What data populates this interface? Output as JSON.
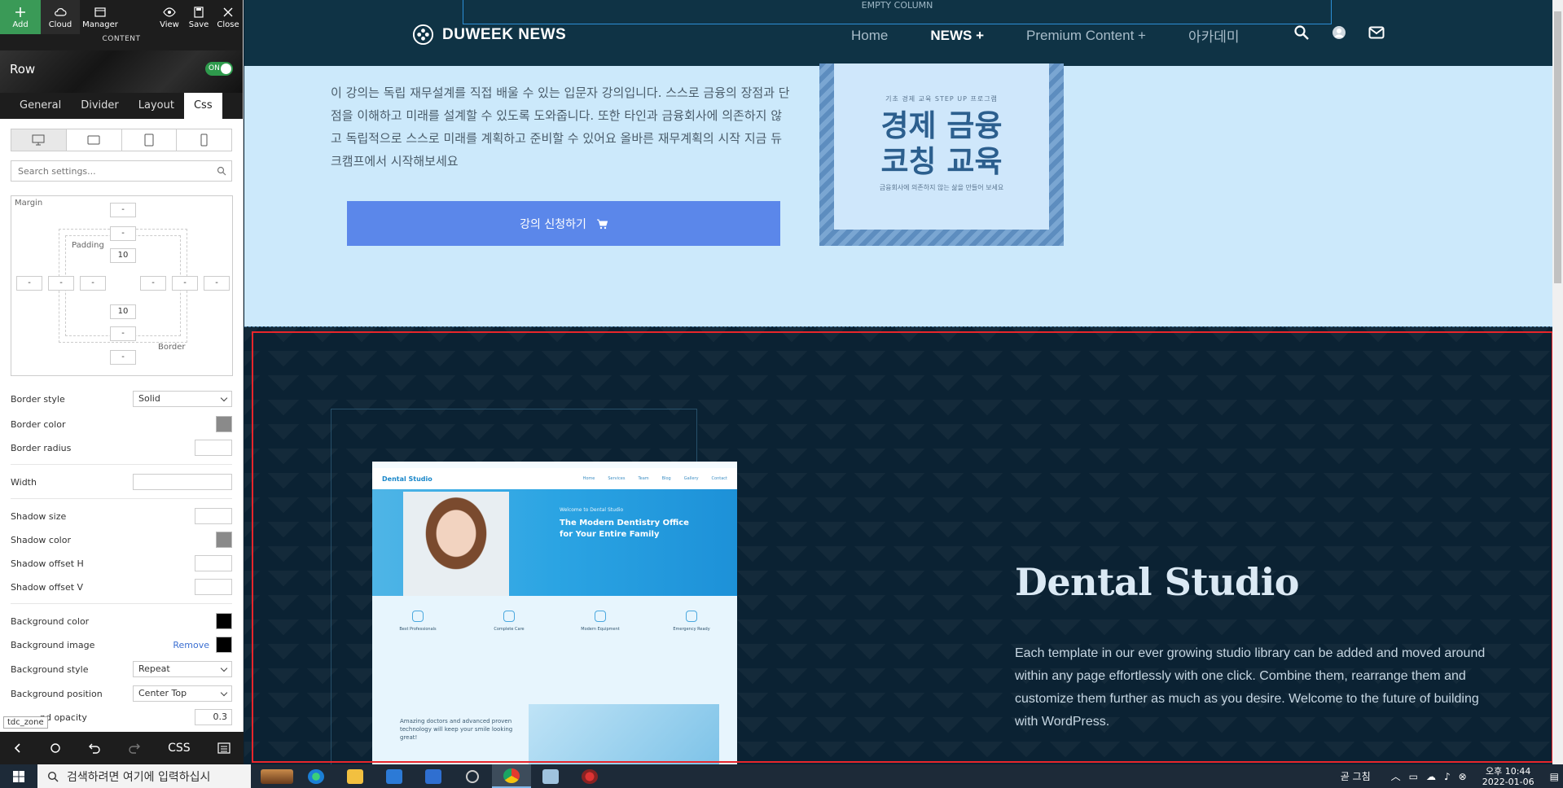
{
  "toolbar": {
    "add": "Add",
    "cloud": "Cloud",
    "manager": "Manager",
    "view": "View",
    "save": "Save",
    "close": "Close",
    "content_label": "CONTENT"
  },
  "row": {
    "title": "Row",
    "toggle": "ON"
  },
  "tabs": [
    "General",
    "Divider",
    "Layout",
    "Css"
  ],
  "search": {
    "placeholder": "Search settings..."
  },
  "box_model": {
    "margin_label": "Margin",
    "padding_label": "Padding",
    "border_label": "Border",
    "margin_top": "-",
    "margin_bottom": "-",
    "margin_left": "-",
    "margin_right": "-",
    "border_top": "-",
    "border_bottom": "-",
    "border_left": "-",
    "border_right": "-",
    "padding_top": "10",
    "padding_bottom": "10",
    "padding_left": "-",
    "padding_right": "-"
  },
  "props": {
    "border_style_label": "Border style",
    "border_style_value": "Solid",
    "border_color_label": "Border color",
    "border_radius_label": "Border radius",
    "width_label": "Width",
    "shadow_size_label": "Shadow size",
    "shadow_color_label": "Shadow color",
    "shadow_offset_h_label": "Shadow offset H",
    "shadow_offset_v_label": "Shadow offset V",
    "bg_color_label": "Background color",
    "bg_image_label": "Background image",
    "bg_image_remove": "Remove",
    "bg_style_label": "Background style",
    "bg_style_value": "Repeat",
    "bg_position_label": "Background position",
    "bg_position_value": "Center Top",
    "bg_opacity_label": "nd opacity",
    "bg_opacity_value": "0.3"
  },
  "tooltip": "tdc_zone",
  "bottom_bar": {
    "css": "CSS"
  },
  "site": {
    "empty_column": "EMPTY COLUMN",
    "logo": "DUWEEK NEWS",
    "nav": [
      "Home",
      "NEWS +",
      "Premium Content +",
      "아카데미"
    ],
    "hero_text": "이 강의는 독립 재무설계를 직접 배울 수 있는 입문자 강의입니다. 스스로 금융의 장점과 단점을 이해하고 미래를 설계할 수 있도록 도와줍니다. 또한 타인과 금융회사에 의존하지 않고 독립적으로 스스로 미래를 계획하고 준비할 수 있어요 올바른 재무계획의 시작 지금 듀크캠프에서 시작해보세요",
    "apply_button": "강의 신청하기",
    "book_sub": "기초 경제 교육 STEP UP 프로그램",
    "book_title_1": "경제 금융",
    "book_title_2": "코칭 교육",
    "book_foot": "금융회사에 의존하지 않는 삶을 만들어 보세요",
    "dental_title": "Dental Studio",
    "dental_desc": "Each template in our ever growing studio library can be added and moved around within any page effortlessly with one click. Combine them, rearrange them and customize them further as much as you desire. Welcome to the future of building with WordPress.",
    "mock": {
      "logo": "Dental Studio",
      "links": [
        "Home",
        "Services",
        "Team",
        "Blog",
        "Gallery",
        "Contact"
      ],
      "welcome": "Welcome to Dental Studio",
      "headline_1": "The Modern Dentistry Office",
      "headline_2": "for Your Entire Family",
      "features": [
        "Best Professionals",
        "Complete Care",
        "Modern Equipment",
        "Emergency Ready"
      ],
      "bottom_text": "Amazing doctors and advanced proven technology will keep your smile looking great!"
    }
  },
  "taskbar": {
    "search_placeholder": "검색하려면 여기에 입력하십시",
    "weather": "곧 그침",
    "time": "오후 10:44",
    "date": "2022-01-06"
  },
  "colors": {
    "header_bg": "#0f3345",
    "hero_bg": "#cce9fb",
    "dark_bg": "#0b2233",
    "button_blue": "#5b87ea",
    "selection_red": "#e8262b",
    "toggle_green": "#2e9a4c"
  }
}
